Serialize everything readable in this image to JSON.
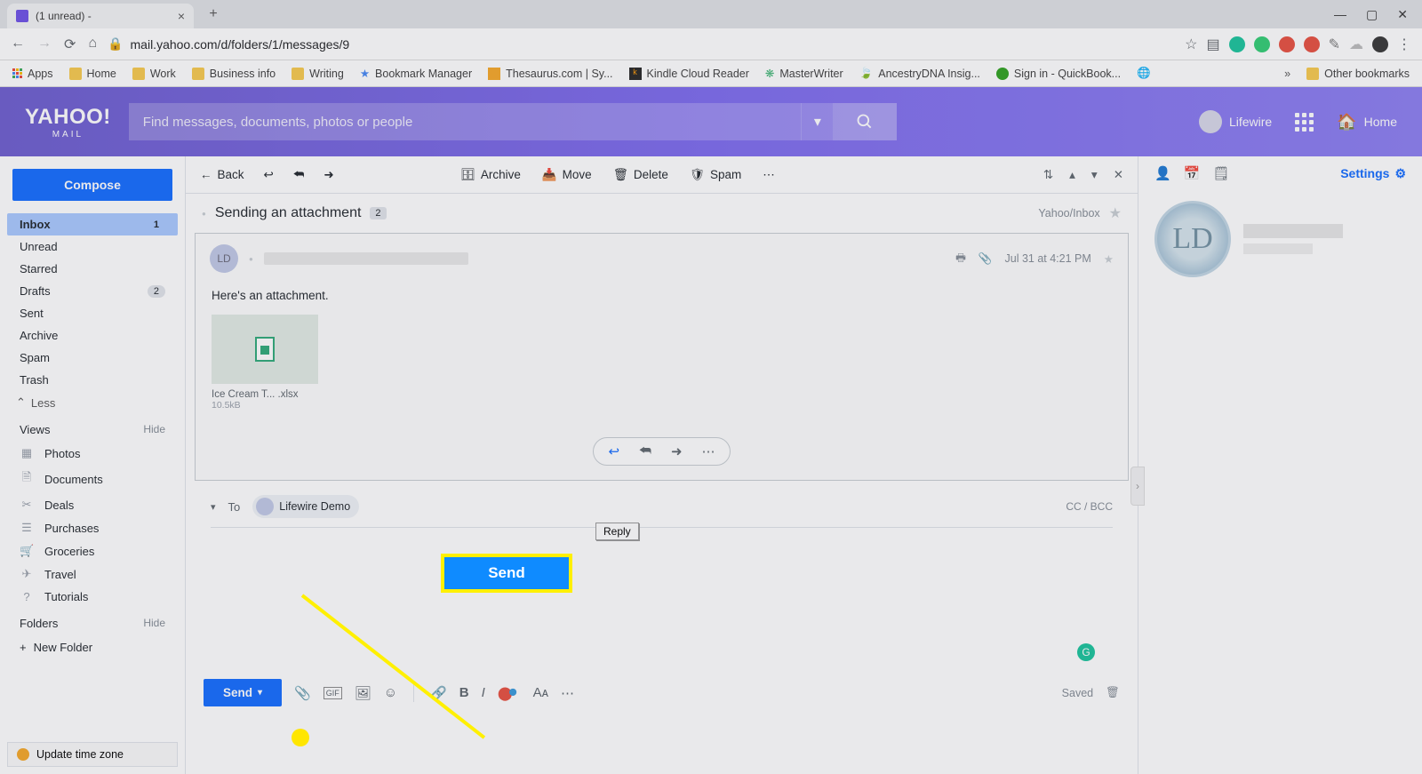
{
  "browser": {
    "tab_title": "(1 unread) -",
    "url": "mail.yahoo.com/d/folders/1/messages/9",
    "bookmarks": [
      "Apps",
      "Home",
      "Work",
      "Business info",
      "Writing",
      "Bookmark Manager",
      "Thesaurus.com | Sy...",
      "Kindle Cloud Reader",
      "MasterWriter",
      "AncestryDNA Insig...",
      "Sign in - QuickBook..."
    ],
    "other_bookmarks": "Other bookmarks"
  },
  "header": {
    "logo_main": "YAHOO!",
    "logo_sub": "MAIL",
    "search_placeholder": "Find messages, documents, photos or people",
    "user": "Lifewire",
    "home": "Home"
  },
  "sidebar": {
    "compose": "Compose",
    "folders": [
      {
        "name": "Inbox",
        "badge": "1",
        "active": true
      },
      {
        "name": "Unread"
      },
      {
        "name": "Starred"
      },
      {
        "name": "Drafts",
        "badge": "2"
      },
      {
        "name": "Sent"
      },
      {
        "name": "Archive"
      },
      {
        "name": "Spam"
      },
      {
        "name": "Trash"
      }
    ],
    "less": "Less",
    "views_label": "Views",
    "hide": "Hide",
    "views": [
      {
        "icon": "▢",
        "name": "Photos"
      },
      {
        "icon": "📄",
        "name": "Documents"
      },
      {
        "icon": "✂",
        "name": "Deals"
      },
      {
        "icon": "☰",
        "name": "Purchases"
      },
      {
        "icon": "🛒",
        "name": "Groceries"
      },
      {
        "icon": "✈",
        "name": "Travel"
      },
      {
        "icon": "?",
        "name": "Tutorials"
      }
    ],
    "folders_label": "Folders",
    "new_folder": "New Folder",
    "tz": "Update time zone"
  },
  "toolbar": {
    "back": "Back",
    "archive": "Archive",
    "move": "Move",
    "delete": "Delete",
    "spam": "Spam"
  },
  "message": {
    "subject": "Sending an attachment",
    "count": "2",
    "location": "Yahoo/Inbox",
    "date": "Jul 31 at 4:21 PM",
    "body": "Here's an attachment.",
    "attach_name": "Ice Cream T... .xlsx",
    "attach_size": "10.5kB",
    "reply_tip": "Reply"
  },
  "compose": {
    "to_label": "To",
    "recipient": "Lifewire Demo",
    "cc": "CC / BCC",
    "send": "Send",
    "saved": "Saved"
  },
  "rail": {
    "settings": "Settings"
  },
  "callout": {
    "send": "Send"
  }
}
